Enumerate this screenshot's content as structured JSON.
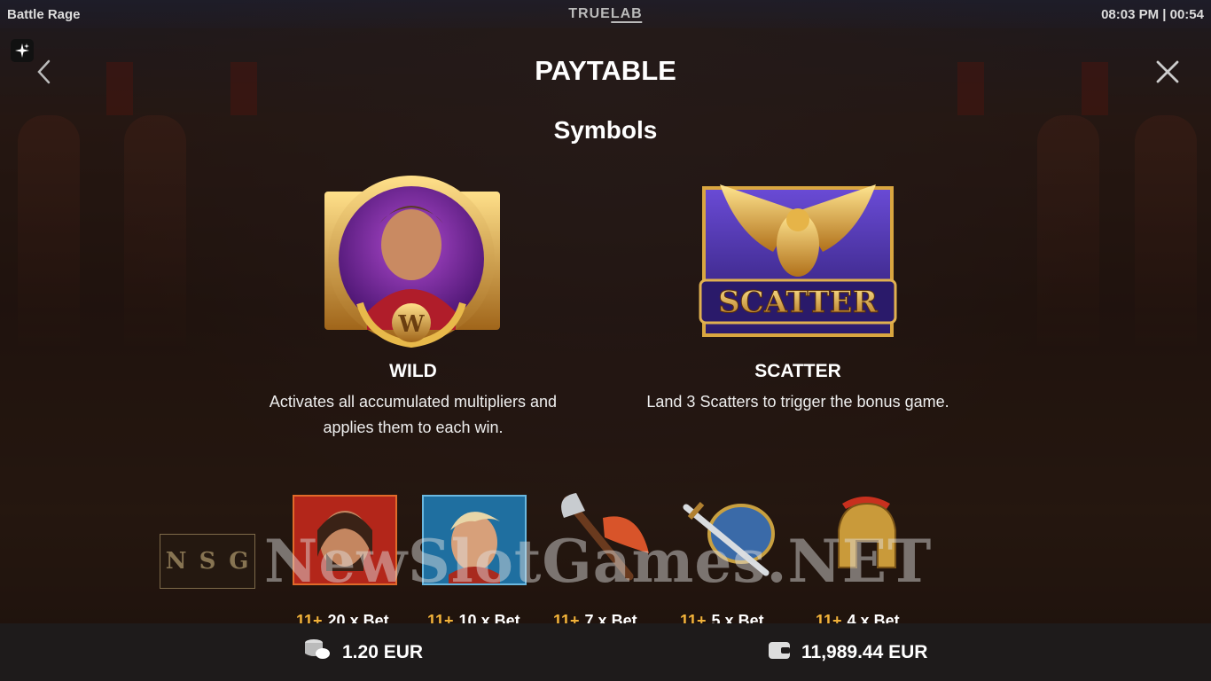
{
  "topbar": {
    "game_title": "Battle Rage",
    "brand_true": "TRUE",
    "brand_lab": "LAB",
    "clock": "08:03 PM | 00:54"
  },
  "page": {
    "title": "PAYTABLE",
    "section_title": "Symbols"
  },
  "special_symbols": [
    {
      "name": "WILD",
      "description_line1": "Activates all accumulated multipliers and",
      "description_line2": "applies them to each win.",
      "icon": "wild-gladiator-emperor-icon",
      "badge": "W"
    },
    {
      "name": "SCATTER",
      "description_line1": "Land 3 Scatters to trigger the bonus game.",
      "icon": "scatter-golden-eagle-icon",
      "badge": "SCATTER"
    }
  ],
  "pay_symbols": [
    {
      "icon": "bearded-gladiator-icon",
      "count": "11+",
      "payout": "20 x Bet"
    },
    {
      "icon": "blond-gladiator-icon",
      "count": "11+",
      "payout": "10 x Bet"
    },
    {
      "icon": "battle-axe-icon",
      "count": "11+",
      "payout": "7 x Bet"
    },
    {
      "icon": "sword-shield-icon",
      "count": "11+",
      "payout": "5 x Bet"
    },
    {
      "icon": "spartan-helmet-icon",
      "count": "11+",
      "payout": "4 x Bet"
    }
  ],
  "watermark": {
    "logo_letters": [
      "N",
      "S",
      "G"
    ],
    "text": "NewSlotGames.NET"
  },
  "bottombar": {
    "bet_amount": "1.20 EUR",
    "balance_amount": "11,989.44 EUR"
  },
  "colors": {
    "accent_gold": "#f2b33a",
    "bottom_bar": "#1e1b1b"
  }
}
